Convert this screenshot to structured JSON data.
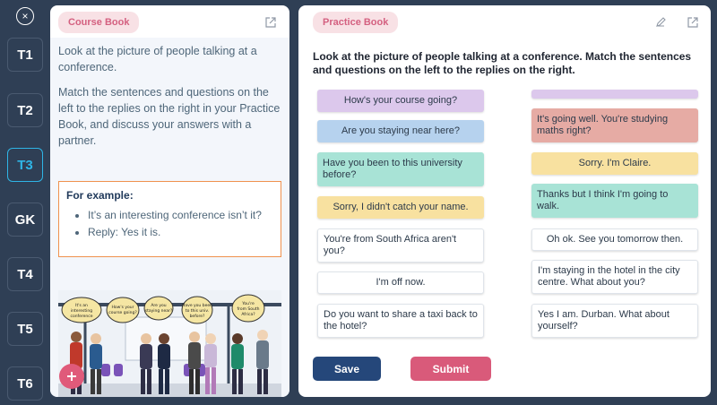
{
  "sidebar": {
    "close_icon": "×",
    "tabs": [
      {
        "label": "T1"
      },
      {
        "label": "T2"
      },
      {
        "label": "T3",
        "active": true
      },
      {
        "label": "GK"
      },
      {
        "label": "T4"
      },
      {
        "label": "T5"
      },
      {
        "label": "T6"
      }
    ]
  },
  "course_book": {
    "title": "Course Book",
    "paragraph1": "Look at the picture of people talking at a conference.",
    "paragraph2": "Match the sentences and questions on the left to the replies on the right in your Practice Book, and discuss your answers with a partner.",
    "example_title": "For example:",
    "example_items": [
      "It’s an interesting conference isn’t it?",
      "Reply: Yes it is."
    ],
    "speech_bubbles": [
      "It's an interesting conference isn't it?",
      "How's your course going?",
      "Are you staying near here?",
      "Have you been to this university before?",
      "You're from South Africa aren't you?"
    ]
  },
  "practice_book": {
    "title": "Practice Book",
    "instructions": "Look at the picture of people talking at a conference. Match the sentences and questions on the left to the replies on the right.",
    "left_cards": [
      "How's your course going?",
      "Are you staying near here?",
      "Have you been to this university before?",
      "Sorry, I didn't catch your name.",
      "You're from South Africa aren't you?",
      "I'm off now.",
      "Do you want to share a taxi back to the hotel?"
    ],
    "right_cards": [
      "",
      "It's going well. You're studying maths right?",
      "Sorry. I'm Claire.",
      "Thanks but I think I'm going to walk.",
      "Oh ok. See you tomorrow then.",
      "I'm staying in the hotel in the city centre. What about you?",
      "Yes I am. Durban. What about yourself?"
    ],
    "save_label": "Save",
    "submit_label": "Submit"
  },
  "icons": {
    "close": "close-icon",
    "expand": "external-link-icon",
    "edit": "pencil-icon",
    "add": "plus-icon"
  },
  "colors": {
    "sidebar": "#2f3f55",
    "active_tab": "#2fb5e6",
    "label_pink": "#d46080",
    "save": "#25477a",
    "submit": "#d95a7a",
    "example_border": "#f0924e"
  }
}
